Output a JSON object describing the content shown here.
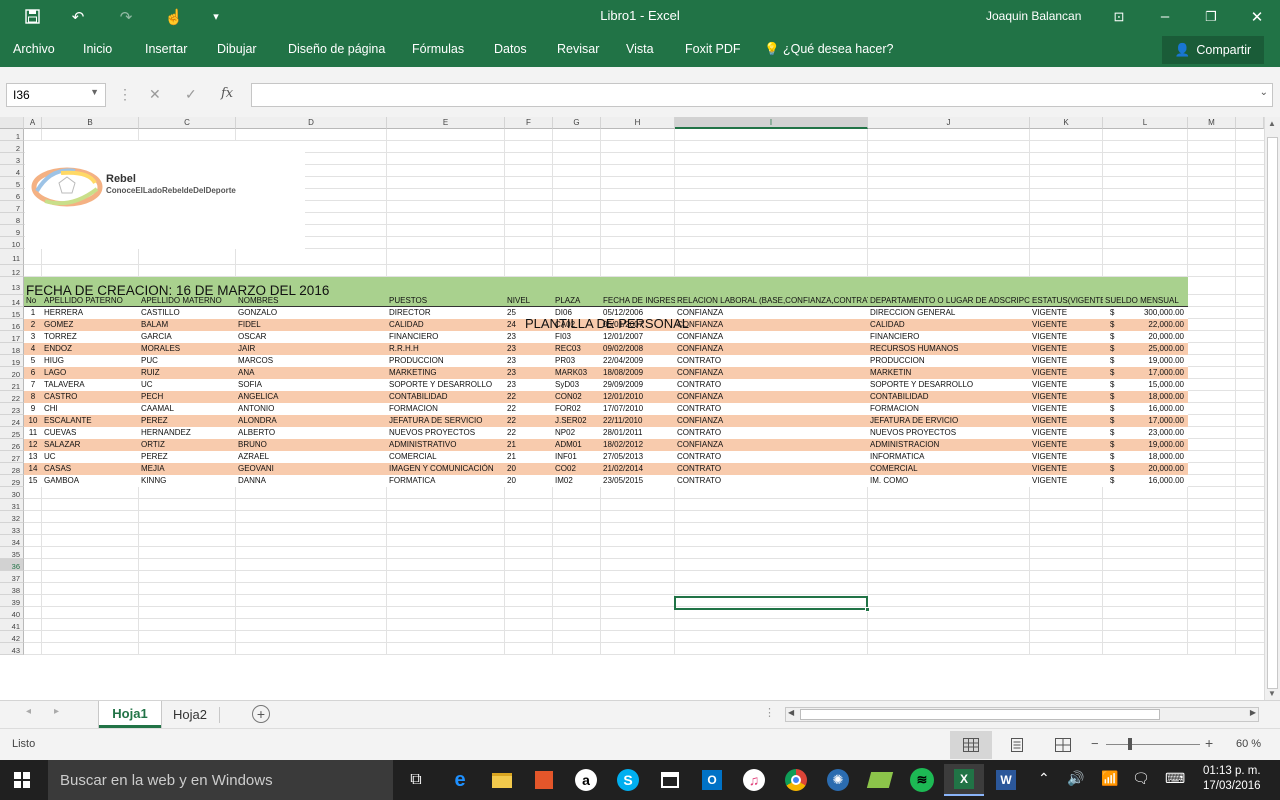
{
  "window": {
    "title": "Libro1 - Excel",
    "user": "Joaquin Balancan"
  },
  "ribbon": {
    "tabs": [
      "Archivo",
      "Inicio",
      "Insertar",
      "Dibujar",
      "Diseño de página",
      "Fórmulas",
      "Datos",
      "Revisar",
      "Vista",
      "Foxit PDF"
    ],
    "tell_me": "¿Qué desea hacer?",
    "share": "Compartir"
  },
  "formula_bar": {
    "name_box": "I36",
    "fx": "fx",
    "value": ""
  },
  "columns": [
    {
      "letter": "A"
    },
    {
      "letter": "B"
    },
    {
      "letter": "C"
    },
    {
      "letter": "D"
    },
    {
      "letter": "E"
    },
    {
      "letter": "F"
    },
    {
      "letter": "G"
    },
    {
      "letter": "H"
    },
    {
      "letter": "I"
    },
    {
      "letter": "J"
    },
    {
      "letter": "K"
    },
    {
      "letter": "L"
    },
    {
      "letter": "M"
    }
  ],
  "rows": [
    "1",
    "2",
    "3",
    "4",
    "5",
    "6",
    "7",
    "8",
    "9",
    "10",
    "11",
    "12",
    "13",
    "14",
    "15",
    "16",
    "17",
    "18",
    "19",
    "20",
    "21",
    "22",
    "23",
    "24",
    "25",
    "26",
    "27",
    "28",
    "29",
    "30",
    "31",
    "32",
    "33",
    "34",
    "35",
    "36",
    "37",
    "38",
    "39",
    "40",
    "41",
    "42",
    "43"
  ],
  "selected_cell": "I36",
  "logo": {
    "name": "Rebel",
    "tagline": "ConoceElLadoRebeldeDelDeporte"
  },
  "sheet": {
    "creation_date": "FECHA DE CREACION: 16 DE MARZO DEL 2016",
    "table_title": "PLANTILLA DE PERSONAL",
    "headers": [
      "No",
      "APELLIDO PATERNO",
      "APELLIDO MATERNO",
      "NOMBRES",
      "PUESTOS",
      "NIVEL",
      "PLAZA",
      "FECHA DE INGRESO",
      "RELACION LABORAL (BASE,CONFIANZA,CONTRATO)",
      "DEPARTAMENTO O LUGAR DE ADSCRIPCION",
      "ESTATUS(VIGENTE)",
      "SUELDO MENSUAL"
    ],
    "employees": [
      [
        "1",
        "HERRERA",
        "CASTILLO",
        "GONZALO",
        "DIRECTOR",
        "25",
        "DI06",
        "05/12/2006",
        "CONFIANZA",
        "DIRECCION GENERAL",
        "VIGENTE",
        "$",
        "300,000.00"
      ],
      [
        "2",
        "GOMEZ",
        "BALAM",
        "FIDEL",
        "CALIDAD",
        "24",
        "CA02",
        "05/01/2007",
        "CONFIANZA",
        "CALIDAD",
        "VIGENTE",
        "$",
        "22,000.00"
      ],
      [
        "3",
        "TORREZ",
        "GARCIA",
        "OSCAR",
        "FINANCIERO",
        "23",
        "FI03",
        "12/01/2007",
        "CONFIANZA",
        "FINANCIERO",
        "VIGENTE",
        "$",
        "20,000.00"
      ],
      [
        "4",
        "ENDOZ",
        "MORALES",
        "JAIR",
        "R.R.H.H",
        "23",
        "REC03",
        "09/02/2008",
        "CONFIANZA",
        "RECURSOS HUMANOS",
        "VIGENTE",
        "$",
        "25,000.00"
      ],
      [
        "5",
        "HIUG",
        "PUC",
        "MARCOS",
        "PRODUCCION",
        "23",
        "PR03",
        "22/04/2009",
        "CONTRATO",
        "PRODUCCION",
        "VIGENTE",
        "$",
        "19,000.00"
      ],
      [
        "6",
        "LAGO",
        "RUIZ",
        "ANA",
        "MARKETING",
        "23",
        "MARK03",
        "18/08/2009",
        "CONFIANZA",
        "MARKETIN",
        "VIGENTE",
        "$",
        "17,000.00"
      ],
      [
        "7",
        "TALAVERA",
        "UC",
        "SOFIA",
        "SOPORTE Y DESARROLLO",
        "23",
        "SyD03",
        "29/09/2009",
        "CONTRATO",
        "SOPORTE Y DESARROLLO",
        "VIGENTE",
        "$",
        "15,000.00"
      ],
      [
        "8",
        "CASTRO",
        "PECH",
        "ANGELICA",
        "CONTABILIDAD",
        "22",
        "CON02",
        "12/01/2010",
        "CONFIANZA",
        "CONTABILIDAD",
        "VIGENTE",
        "$",
        "18,000.00"
      ],
      [
        "9",
        "CHI",
        "CAAMAL",
        "ANTONIO",
        "FORMACION",
        "22",
        "FOR02",
        "17/07/2010",
        "CONTRATO",
        "FORMACION",
        "VIGENTE",
        "$",
        "16,000.00"
      ],
      [
        "10",
        "ESCALANTE",
        "PEREZ",
        "ALONDRA",
        "JEFATURA DE SERVICIO",
        "22",
        "J.SER02",
        "22/11/2010",
        "CONFIANZA",
        "JEFATURA DE ERVICIO",
        "VIGENTE",
        "$",
        "17,000.00"
      ],
      [
        "11",
        "CUEVAS",
        "HERNANDEZ",
        "ALBERTO",
        "NUEVOS PROYECTOS",
        "22",
        "NP02",
        "28/01/2011",
        "CONTRATO",
        "NUEVOS PROYECTOS",
        "VIGENTE",
        "$",
        "23,000.00"
      ],
      [
        "12",
        "SALAZAR",
        "ORTIZ",
        "BRUNO",
        "ADMINISTRATIVO",
        "21",
        "ADM01",
        "18/02/2012",
        "CONFIANZA",
        "ADMINISTRACION",
        "VIGENTE",
        "$",
        "19,000.00"
      ],
      [
        "13",
        "UC",
        "PEREZ",
        "AZRAEL",
        "COMERCIAL",
        "21",
        "INF01",
        "27/05/2013",
        "CONTRATO",
        "INFORMATICA",
        "VIGENTE",
        "$",
        "18,000.00"
      ],
      [
        "14",
        "CASAS",
        "MEJIA",
        "GEOVANI",
        "IMAGEN Y COMUNICACIÓN",
        "20",
        "CO02",
        "21/02/2014",
        "CONTRATO",
        "COMERCIAL",
        "VIGENTE",
        "$",
        "20,000.00"
      ],
      [
        "15",
        "GAMBOA",
        "KINNG",
        "DANNA",
        "FORMATICA",
        "20",
        "IM02",
        "23/05/2015",
        "CONTRATO",
        "IM. COMO",
        "VIGENTE",
        "$",
        "16,000.00"
      ]
    ]
  },
  "sheet_tabs": [
    "Hoja1",
    "Hoja2"
  ],
  "active_sheet": "Hoja1",
  "status": {
    "ready": "Listo",
    "zoom": "60 %"
  },
  "taskbar": {
    "search_placeholder": "Buscar en la web y en Windows",
    "time": "01:13 p. m.",
    "date": "17/03/2016"
  },
  "colors": {
    "excel_green": "#217346",
    "header_green": "#a9d18e",
    "stripe_peach": "#f8cbad",
    "row_white": "#ffffff"
  }
}
